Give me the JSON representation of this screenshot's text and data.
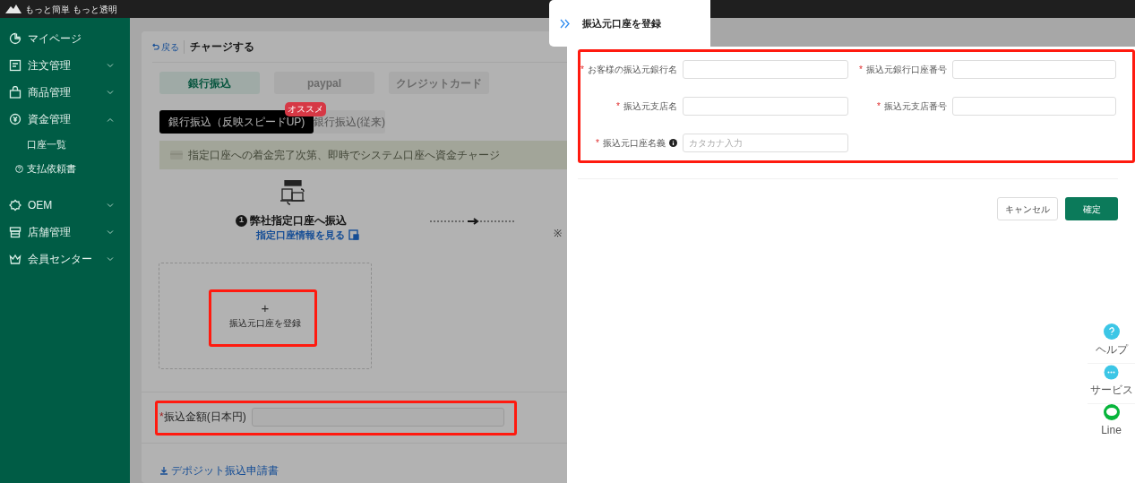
{
  "top_bar": {
    "tagline": "もっと簡単 もっと透明"
  },
  "sidebar": {
    "items": [
      {
        "label": "マイページ"
      },
      {
        "label": "注文管理",
        "expanded": false
      },
      {
        "label": "商品管理",
        "expanded": false
      },
      {
        "label": "資金管理",
        "expanded": true,
        "children": [
          {
            "label": "口座一覧",
            "kind": "plain"
          },
          {
            "label": "支払依頼書",
            "kind": "help"
          }
        ]
      },
      {
        "label": "OEM",
        "expanded": false
      },
      {
        "label": "店舗管理",
        "expanded": false
      },
      {
        "label": "会員センター",
        "expanded": false
      }
    ]
  },
  "main": {
    "back_link": "戻る",
    "title": "チャージする",
    "payment_tabs": [
      {
        "label": "銀行振込",
        "selected": true
      },
      {
        "label": "paypal",
        "selected": false
      },
      {
        "label": "クレジットカード",
        "selected": false
      }
    ],
    "sub_tabs": [
      {
        "label": "銀行振込（反映スピードUP)",
        "selected": true,
        "badge": "オススメ"
      },
      {
        "label": "銀行振込(従来)",
        "selected": false
      }
    ],
    "notice": "指定口座への着金完了次第、即時でシステム口座へ資金チャージ",
    "step": {
      "number": "1",
      "title": "弊社指定口座へ振込",
      "link": "指定口座情報を見る",
      "note_mark": "※"
    },
    "add_account": {
      "plus": "+",
      "label": "振込元口座を登録"
    },
    "amount": {
      "label": "振込金額(日本円)",
      "required_mark": "*"
    },
    "download_link": "デポジット振込申請書"
  },
  "drawer": {
    "title": "振込元口座を登録",
    "fields": [
      {
        "label": "お客様の振込元銀行名",
        "required_mark": "*"
      },
      {
        "label": "振込元銀行口座番号",
        "required_mark": "*"
      },
      {
        "label": "振込元支店名",
        "required_mark": "*"
      },
      {
        "label": "振込元支店番号",
        "required_mark": "*"
      },
      {
        "label": "振込元口座名義",
        "required_mark": "*",
        "info": true,
        "placeholder": "カタカナ入力"
      }
    ],
    "buttons": [
      {
        "label": "キャンセル",
        "kind": "secondary"
      },
      {
        "label": "確定",
        "kind": "primary"
      }
    ]
  },
  "help_widget": {
    "items": [
      {
        "label": "ヘルプ"
      },
      {
        "label": "サービス"
      },
      {
        "label": "Line"
      }
    ]
  }
}
